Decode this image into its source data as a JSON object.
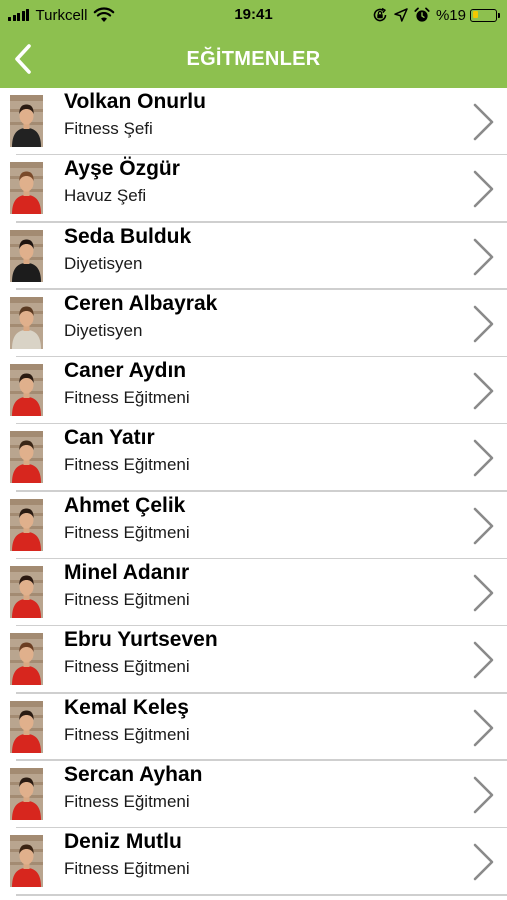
{
  "status_bar": {
    "carrier": "Turkcell",
    "time": "19:41",
    "battery": "%19",
    "icons": [
      "signal-icon",
      "wifi-icon",
      "screen-lock-icon",
      "location-icon",
      "alarm-icon",
      "battery-icon"
    ]
  },
  "nav": {
    "title": "EĞİTMENLER",
    "back_icon": "chevron-left-icon"
  },
  "colors": {
    "header": "#8dc04f",
    "title": "#ffffff",
    "separator": "#cfcfcf",
    "chevron": "#8a8a8a",
    "shirt_red": "#d7261e",
    "shirt_black": "#222222",
    "battery_low": "#f3c800"
  },
  "instructors": [
    {
      "name": "Volkan Onurlu",
      "role": "Fitness Şefi",
      "shirt": "#222222",
      "hair": "#2a1b12"
    },
    {
      "name": "Ayşe Özgür",
      "role": "Havuz Şefi",
      "shirt": "#d7261e",
      "hair": "#7a4a2a"
    },
    {
      "name": "Seda Bulduk",
      "role": "Diyetisyen",
      "shirt": "#1c1c1c",
      "hair": "#1e1410"
    },
    {
      "name": "Ceren Albayrak",
      "role": "Diyetisyen",
      "shirt": "#d9d3c6",
      "hair": "#5a3a22"
    },
    {
      "name": "Caner Aydın",
      "role": "Fitness Eğitmeni",
      "shirt": "#d7261e",
      "hair": "#2a1b12"
    },
    {
      "name": "Can Yatır",
      "role": "Fitness Eğitmeni",
      "shirt": "#d7261e",
      "hair": "#3a2616"
    },
    {
      "name": "Ahmet Çelik",
      "role": "Fitness Eğitmeni",
      "shirt": "#d7261e",
      "hair": "#2a1b12"
    },
    {
      "name": "Minel Adanır",
      "role": "Fitness Eğitmeni",
      "shirt": "#d7261e",
      "hair": "#2a1810"
    },
    {
      "name": "Ebru Yurtseven",
      "role": "Fitness Eğitmeni",
      "shirt": "#d7261e",
      "hair": "#6b3e22"
    },
    {
      "name": "Kemal Keleş",
      "role": "Fitness Eğitmeni",
      "shirt": "#d7261e",
      "hair": "#2a1b12"
    },
    {
      "name": "Sercan Ayhan",
      "role": "Fitness Eğitmeni",
      "shirt": "#d7261e",
      "hair": "#2a1b12"
    },
    {
      "name": "Deniz Mutlu",
      "role": "Fitness Eğitmeni",
      "shirt": "#d7261e",
      "hair": "#3a2414"
    }
  ]
}
